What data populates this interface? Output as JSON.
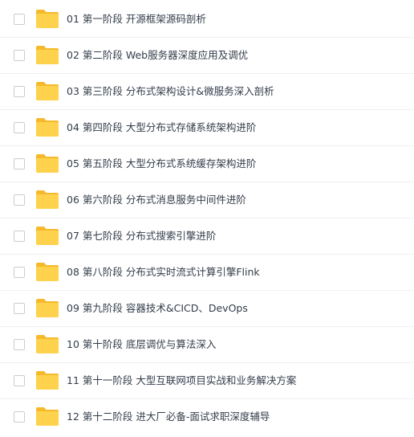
{
  "file_list": {
    "items": [
      {
        "name": "01 第一阶段 开源框架源码剖析",
        "type": "folder"
      },
      {
        "name": "02 第二阶段 Web服务器深度应用及调优",
        "type": "folder"
      },
      {
        "name": "03 第三阶段 分布式架构设计&微服务深入剖析",
        "type": "folder"
      },
      {
        "name": "04 第四阶段 大型分布式存储系统架构进阶",
        "type": "folder"
      },
      {
        "name": "05 第五阶段 大型分布式系统缓存架构进阶",
        "type": "folder"
      },
      {
        "name": "06 第六阶段 分布式消息服务中间件进阶",
        "type": "folder"
      },
      {
        "name": "07 第七阶段 分布式搜索引擎进阶",
        "type": "folder"
      },
      {
        "name": "08 第八阶段 分布式实时流式计算引擎Flink",
        "type": "folder"
      },
      {
        "name": "09 第九阶段 容器技术&CICD、DevOps",
        "type": "folder"
      },
      {
        "name": "10 第十阶段 底层调优与算法深入",
        "type": "folder"
      },
      {
        "name": "11 第十一阶段 大型互联网项目实战和业务解决方案",
        "type": "folder"
      },
      {
        "name": "12 第十二阶段 进大厂必备-面试求职深度辅导",
        "type": "folder"
      }
    ]
  },
  "colors": {
    "folder_body": "#ffd24d",
    "folder_back": "#f6b92b",
    "text": "#333c4a",
    "checkbox_border": "#c9ccd2"
  },
  "icons": {
    "folder": "folder-icon",
    "checkbox": "checkbox"
  }
}
